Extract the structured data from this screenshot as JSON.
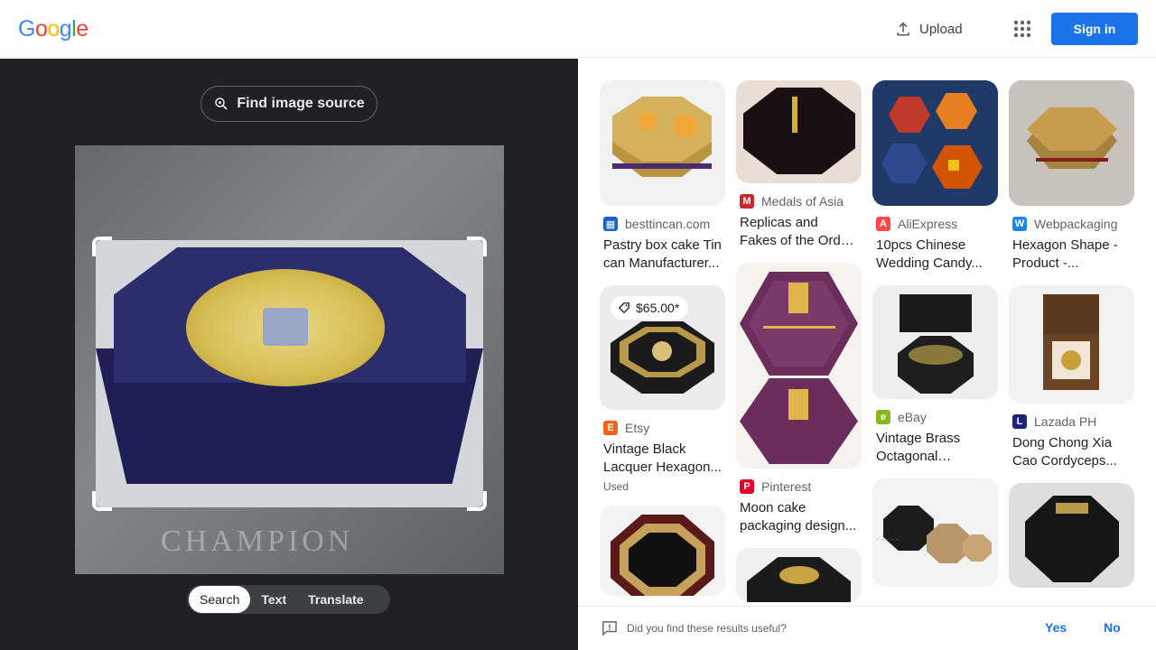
{
  "header": {
    "logo_letters": [
      {
        "ch": "G",
        "color": "#4285f4"
      },
      {
        "ch": "o",
        "color": "#ea4335"
      },
      {
        "ch": "o",
        "color": "#fbbc05"
      },
      {
        "ch": "g",
        "color": "#4285f4"
      },
      {
        "ch": "l",
        "color": "#34a853"
      },
      {
        "ch": "e",
        "color": "#ea4335"
      }
    ],
    "upload_label": "Upload",
    "signin_label": "Sign in",
    "accent": "#1a73e8"
  },
  "left": {
    "find_source_label": "Find image source",
    "watermark_text": "CHAMPION",
    "modes": [
      "Search",
      "Text",
      "Translate"
    ],
    "active_mode": "Search"
  },
  "results": [
    [
      {
        "thumb": "gold-octagon",
        "source": "besttincan.com",
        "fav_color": "#1565c0",
        "fav_char": "▦",
        "title": "Pastry box cake Tin can Manufacturer..."
      },
      {
        "thumb": "black-bagua",
        "price": "$65.00*",
        "source": "Etsy",
        "fav_color": "#f1641e",
        "fav_char": "E",
        "title": "Vintage Black Lacquer Hexagon...",
        "sub": "Used"
      },
      {
        "thumb": "plaque",
        "source": "",
        "title": ""
      }
    ],
    [
      {
        "thumb": "dark-octagon",
        "source": "Medals of Asia",
        "fav_color": "#c62828",
        "fav_char": "M",
        "title": "Replicas and Fakes of the Order of th..."
      },
      {
        "thumb": "purple-hex",
        "source": "Pinterest",
        "fav_color": "#e60023",
        "fav_char": "P",
        "title": "Moon cake packaging design..."
      },
      {
        "thumb": "gold-dark",
        "source": "",
        "title": ""
      }
    ],
    [
      {
        "thumb": "color-boxes",
        "source": "AliExpress",
        "fav_color": "#ff4747",
        "fav_char": "A",
        "title": "10pcs Chinese Wedding Candy..."
      },
      {
        "thumb": "sundial",
        "source": "eBay",
        "fav_color": "#86b817",
        "fav_char": "e",
        "title": "Vintage Brass Octagonal Sundia..."
      },
      {
        "thumb": "stack-boxes",
        "source": "",
        "title": ""
      }
    ],
    [
      {
        "thumb": "gold-hex",
        "source": "Webpackaging",
        "fav_color": "#1e88e5",
        "fav_char": "W",
        "title": "Hexagon Shape - Product -..."
      },
      {
        "thumb": "wood-box",
        "source": "Lazada PH",
        "fav_color": "#1a237e",
        "fav_char": "L",
        "title": "Dong Chong Xia Cao Cordyceps..."
      },
      {
        "thumb": "black-octagon",
        "source": "",
        "title": ""
      }
    ]
  ],
  "feedback": {
    "question": "Did you find these results useful?",
    "yes": "Yes",
    "no": "No"
  }
}
